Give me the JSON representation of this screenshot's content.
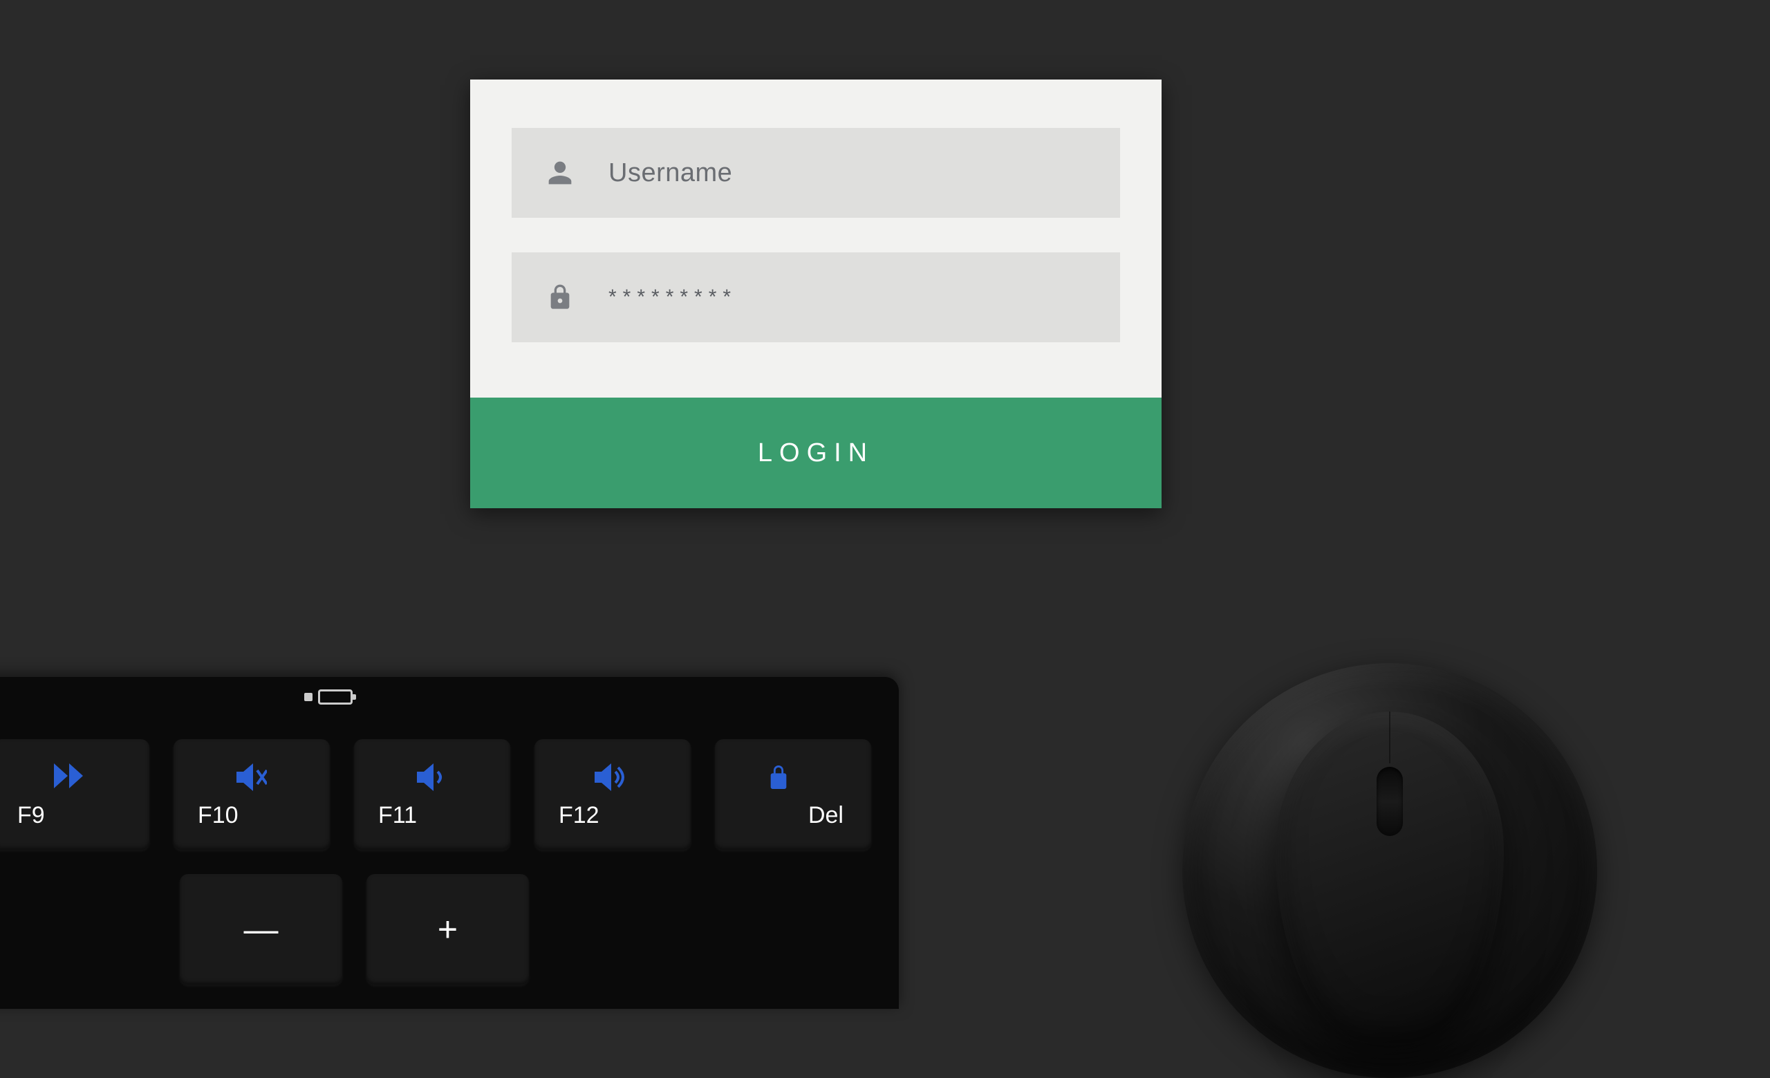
{
  "login": {
    "username_placeholder": "Username",
    "password_masked": "*********",
    "button_label": "LOGIN"
  },
  "keyboard": {
    "fkeys": [
      {
        "icon": "fast-forward",
        "label": "F9"
      },
      {
        "icon": "mute",
        "label": "F10"
      },
      {
        "icon": "volume-down",
        "label": "F11"
      },
      {
        "icon": "volume-up",
        "label": "F12"
      },
      {
        "icon": "lock",
        "label": "Del"
      }
    ],
    "row2": [
      {
        "label": "—"
      },
      {
        "label": "+"
      }
    ]
  }
}
